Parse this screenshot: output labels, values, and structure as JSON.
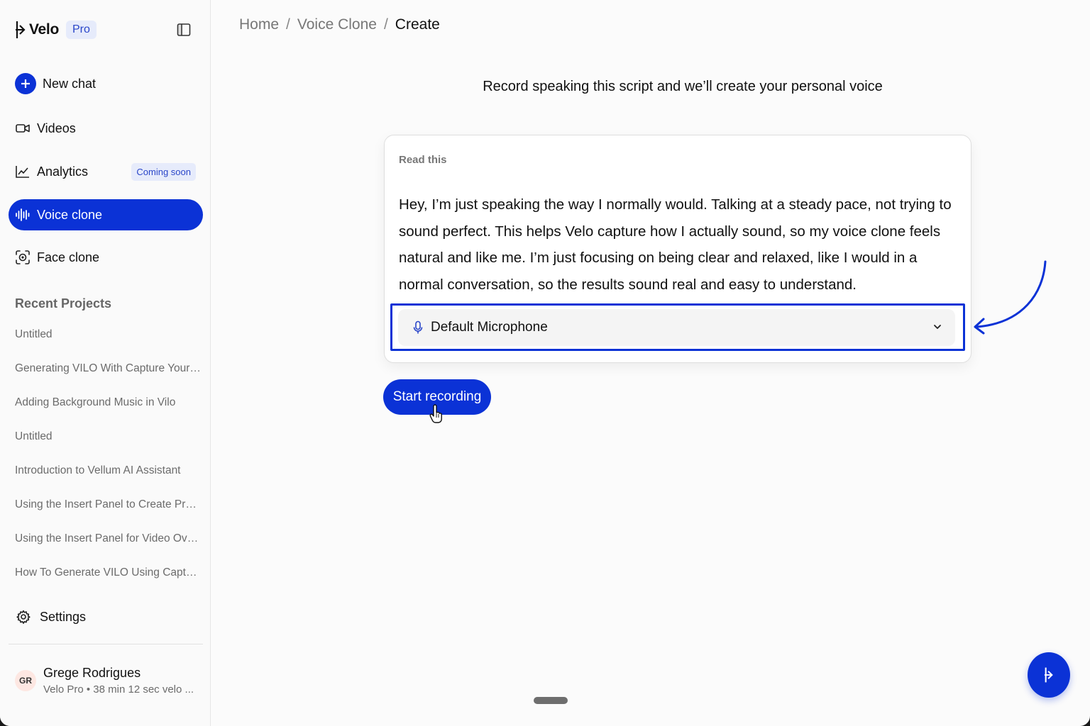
{
  "brand": {
    "name": "Velo",
    "badge": "Pro"
  },
  "sidebar": {
    "new_chat": "New chat",
    "items": [
      {
        "label": "Videos",
        "icon": "video-icon"
      },
      {
        "label": "Analytics",
        "icon": "chart-line-icon",
        "badge": "Coming soon"
      },
      {
        "label": "Voice clone",
        "icon": "waveform-icon",
        "active": true
      },
      {
        "label": "Face clone",
        "icon": "face-scan-icon"
      }
    ],
    "recent_title": "Recent Projects",
    "recent_projects": [
      "Untitled",
      "Generating VILO With Capture Your ...",
      "Adding Background Music in Vilo",
      "Untitled",
      "Introduction to Vellum AI Assistant",
      "Using the Insert Panel to Create Prof...",
      "Using the Insert Panel for Video Ove...",
      "How To Generate VILO Using Captur..."
    ],
    "settings": "Settings",
    "user": {
      "initials": "GR",
      "name": "Grege Rodrigues",
      "plan": "Velo Pro • 38 min 12 sec velo ..."
    }
  },
  "breadcrumb": {
    "home": "Home",
    "section": "Voice Clone",
    "current": "Create",
    "separator": "/"
  },
  "main": {
    "instruction": "Record speaking this script and we’ll create your personal voice",
    "card_label": "Read this",
    "script": "Hey, I’m just speaking the way I normally would. Talking at a steady pace, not trying to sound perfect. This helps Velo capture how I actually sound, so my voice clone feels natural and like me. I’m just focusing on being clear and relaxed, like I would in a normal conversation, so the results sound real and easy to understand.",
    "microphone": {
      "selected": "Default Microphone"
    },
    "record_button": "Start recording"
  },
  "colors": {
    "accent": "#0b32d6",
    "badge_bg": "#e6ebfb",
    "badge_text": "#2a46c9"
  }
}
